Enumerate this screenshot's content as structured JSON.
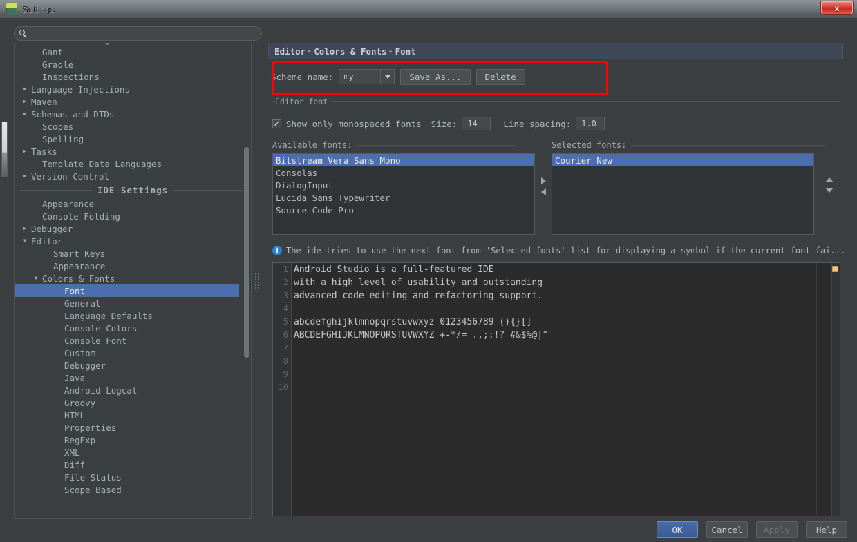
{
  "window": {
    "title": "Settings",
    "app_icon": "android-studio-icon",
    "close_label": "x"
  },
  "search": {
    "value": "",
    "placeholder": "",
    "icon": "search-icon"
  },
  "sidebar": {
    "project_items": [
      {
        "label": "File Encodings",
        "expandable": false,
        "indent": 1,
        "clipped": true
      },
      {
        "label": "Gant",
        "expandable": false,
        "indent": 1
      },
      {
        "label": "Gradle",
        "expandable": false,
        "indent": 1
      },
      {
        "label": "Inspections",
        "expandable": false,
        "indent": 1
      },
      {
        "label": "Language Injections",
        "expandable": true,
        "indent": 0
      },
      {
        "label": "Maven",
        "expandable": true,
        "indent": 0
      },
      {
        "label": "Schemas and DTDs",
        "expandable": true,
        "indent": 0
      },
      {
        "label": "Scopes",
        "expandable": false,
        "indent": 1
      },
      {
        "label": "Spelling",
        "expandable": false,
        "indent": 1
      },
      {
        "label": "Tasks",
        "expandable": true,
        "indent": 0
      },
      {
        "label": "Template Data Languages",
        "expandable": false,
        "indent": 1
      },
      {
        "label": "Version Control",
        "expandable": true,
        "indent": 0
      }
    ],
    "separator_label": "IDE Settings",
    "ide_items": [
      {
        "label": "Appearance",
        "expandable": false,
        "indent": 1
      },
      {
        "label": "Console Folding",
        "expandable": false,
        "indent": 1
      },
      {
        "label": "Debugger",
        "expandable": true,
        "indent": 0
      },
      {
        "label": "Editor",
        "expandable": true,
        "expanded": true,
        "indent": 0
      },
      {
        "label": "Smart Keys",
        "expandable": false,
        "indent": 2
      },
      {
        "label": "Appearance",
        "expandable": false,
        "indent": 2
      },
      {
        "label": "Colors & Fonts",
        "expandable": true,
        "expanded": true,
        "indent": 1
      },
      {
        "label": "Font",
        "expandable": false,
        "indent": 3,
        "selected": true
      },
      {
        "label": "General",
        "expandable": false,
        "indent": 3
      },
      {
        "label": "Language Defaults",
        "expandable": false,
        "indent": 3
      },
      {
        "label": "Console Colors",
        "expandable": false,
        "indent": 3
      },
      {
        "label": "Console Font",
        "expandable": false,
        "indent": 3
      },
      {
        "label": "Custom",
        "expandable": false,
        "indent": 3
      },
      {
        "label": "Debugger",
        "expandable": false,
        "indent": 3
      },
      {
        "label": "Java",
        "expandable": false,
        "indent": 3
      },
      {
        "label": "Android Logcat",
        "expandable": false,
        "indent": 3
      },
      {
        "label": "Groovy",
        "expandable": false,
        "indent": 3
      },
      {
        "label": "HTML",
        "expandable": false,
        "indent": 3
      },
      {
        "label": "Properties",
        "expandable": false,
        "indent": 3
      },
      {
        "label": "RegExp",
        "expandable": false,
        "indent": 3
      },
      {
        "label": "XML",
        "expandable": false,
        "indent": 3
      },
      {
        "label": "Diff",
        "expandable": false,
        "indent": 3
      },
      {
        "label": "File Status",
        "expandable": false,
        "indent": 3
      },
      {
        "label": "Scope Based",
        "expandable": false,
        "indent": 3
      }
    ]
  },
  "breadcrumb": {
    "parts": [
      "Editor",
      "Colors & Fonts",
      "Font"
    ],
    "separator": "▸"
  },
  "scheme": {
    "label": "Scheme name:",
    "value": "my",
    "options": [
      "my"
    ],
    "save_as_label": "Save As...",
    "delete_label": "Delete"
  },
  "annotation": {
    "color": "#fe0000",
    "name": "red-highlight-rectangle"
  },
  "editor_font": {
    "group_title": "Editor font",
    "monospaced_label": "Show only monospaced fonts",
    "monospaced_checked": true,
    "size_label": "Size:",
    "size_value": "14",
    "line_spacing_label": "Line spacing:",
    "line_spacing_value": "1.0"
  },
  "available_fonts": {
    "caption": "Available fonts:",
    "items": [
      {
        "label": "Bitstream Vera Sans Mono",
        "selected": true
      },
      {
        "label": "Consolas",
        "selected": false
      },
      {
        "label": "DialogInput",
        "selected": false
      },
      {
        "label": "Lucida Sans Typewriter",
        "selected": false
      },
      {
        "label": "Source Code Pro",
        "selected": false
      }
    ]
  },
  "selected_fonts": {
    "caption": "Selected fonts:",
    "items": [
      {
        "label": "Courier New",
        "selected": true
      }
    ]
  },
  "info": {
    "icon": "info-icon",
    "text": "The ide tries to use the next font from 'Selected fonts' list for displaying a symbol if the current font fai..."
  },
  "preview": {
    "line_numbers": [
      "1",
      "2",
      "3",
      "4",
      "5",
      "6",
      "7",
      "8",
      "9",
      "10"
    ],
    "lines": [
      "Android Studio is a full-featured IDE",
      "with a high level of usability and outstanding",
      "advanced code editing and refactoring support.",
      "",
      "abcdefghijklmnopqrstuvwxyz 0123456789 (){}[]",
      "ABCDEFGHIJKLMNOPQRSTUVWXYZ +-*/= .,;:!? #&$%@|^",
      "",
      "",
      "",
      ""
    ],
    "marker_color": "#f5c77e"
  },
  "footer": {
    "ok_label": "OK",
    "cancel_label": "Cancel",
    "apply_label": "Apply",
    "help_label": "Help",
    "apply_enabled": false
  },
  "colors": {
    "accent_selection": "#4b6eaf",
    "window_bg": "#3c3f41",
    "editor_bg": "#2b2b2b",
    "annotation": "#fe0000",
    "info_blue": "#2d7fd4"
  }
}
